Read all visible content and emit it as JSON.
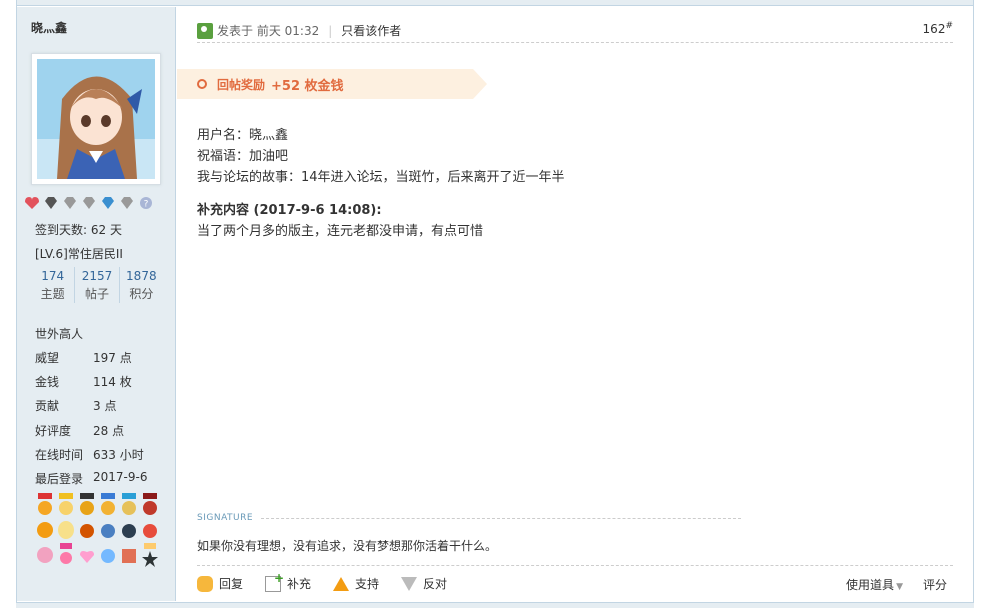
{
  "user": {
    "name": "晓灬鑫",
    "signin_days": "签到天数: 62 天",
    "level": "[LV.6]常住居民II",
    "counts": [
      {
        "n": "174",
        "label": "主题"
      },
      {
        "n": "2157",
        "label": "帖子"
      },
      {
        "n": "1878",
        "label": "积分"
      }
    ],
    "group": "世外高人",
    "stats": [
      {
        "k": "威望",
        "v": "197 点"
      },
      {
        "k": "金钱",
        "v": "114 枚"
      },
      {
        "k": "贡献",
        "v": "3 点"
      },
      {
        "k": "好评度",
        "v": "28 点"
      },
      {
        "k": "在线时间",
        "v": "633 小时"
      },
      {
        "k": "最后登录",
        "v": "2017-9-6"
      }
    ]
  },
  "post": {
    "posted_label": "发表于 前天 01:32",
    "only_author": "只看该作者",
    "floor": "162",
    "floor_mark": "#",
    "reward_label": "回帖奖励",
    "reward_amount": "+52 枚金钱",
    "lines": [
      "用户名：晓灬鑫",
      "祝福语：加油吧",
      "我与论坛的故事：14年进入论坛，当斑竹，后来离开了近一年半"
    ],
    "supplement_title": "补充内容 (2017-9-6 14:08):",
    "supplement_text": "当了两个月多的版主，连元老都没申请，有点可惜",
    "signature_label": "SIGNATURE",
    "signature": "如果你没有理想，没有追求，没有梦想那你活着干什么。"
  },
  "actions": {
    "reply": "回复",
    "add": "补充",
    "support": "支持",
    "oppose": "反对",
    "use_tool": "使用道具",
    "rate": "评分"
  }
}
